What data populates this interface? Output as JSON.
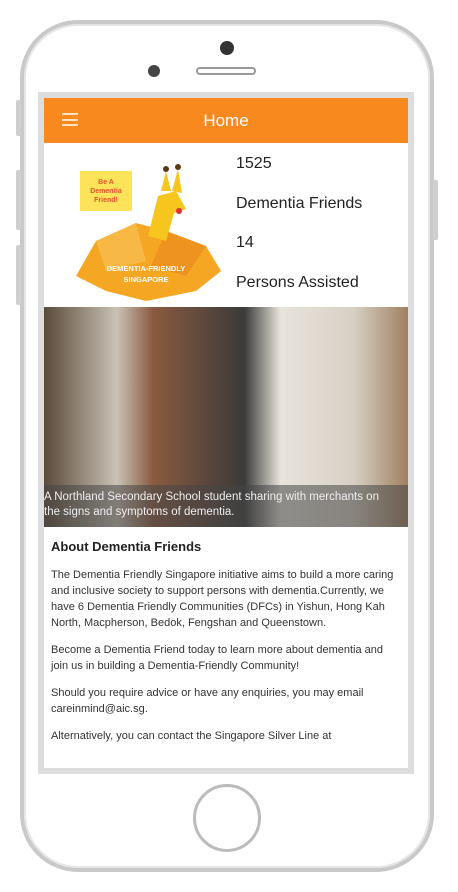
{
  "header": {
    "title": "Home"
  },
  "logo": {
    "bubble": "Be A Dementia Friend!",
    "text1": "DEMENTIA-FRIENDLY",
    "text2": "SINGAPORE"
  },
  "stats": [
    {
      "value": "1525",
      "label": "Dementia Friends"
    },
    {
      "value": "14",
      "label": "Persons Assisted"
    }
  ],
  "photo": {
    "caption_line1": "A Northland Secondary School student sharing with merchants on",
    "caption_line2": "the signs and symptoms of dementia."
  },
  "about": {
    "title": "About Dementia Friends",
    "paragraphs": [
      "The Dementia Friendly Singapore initiative aims to build a more caring and inclusive society to support persons with dementia.Currently, we have 6 Dementia Friendly Communities (DFCs) in Yishun, Hong Kah North, Macpherson, Bedok, Fengshan and Queenstown.",
      "Become a Dementia Friend today to learn more about dementia and join us in building a Dementia-Friendly Community!",
      "Should you require advice or have any enquiries, you may email careinmind@aic.sg.",
      "Alternatively, you can contact the Singapore Silver Line at"
    ]
  },
  "colors": {
    "accent": "#f7891f"
  }
}
